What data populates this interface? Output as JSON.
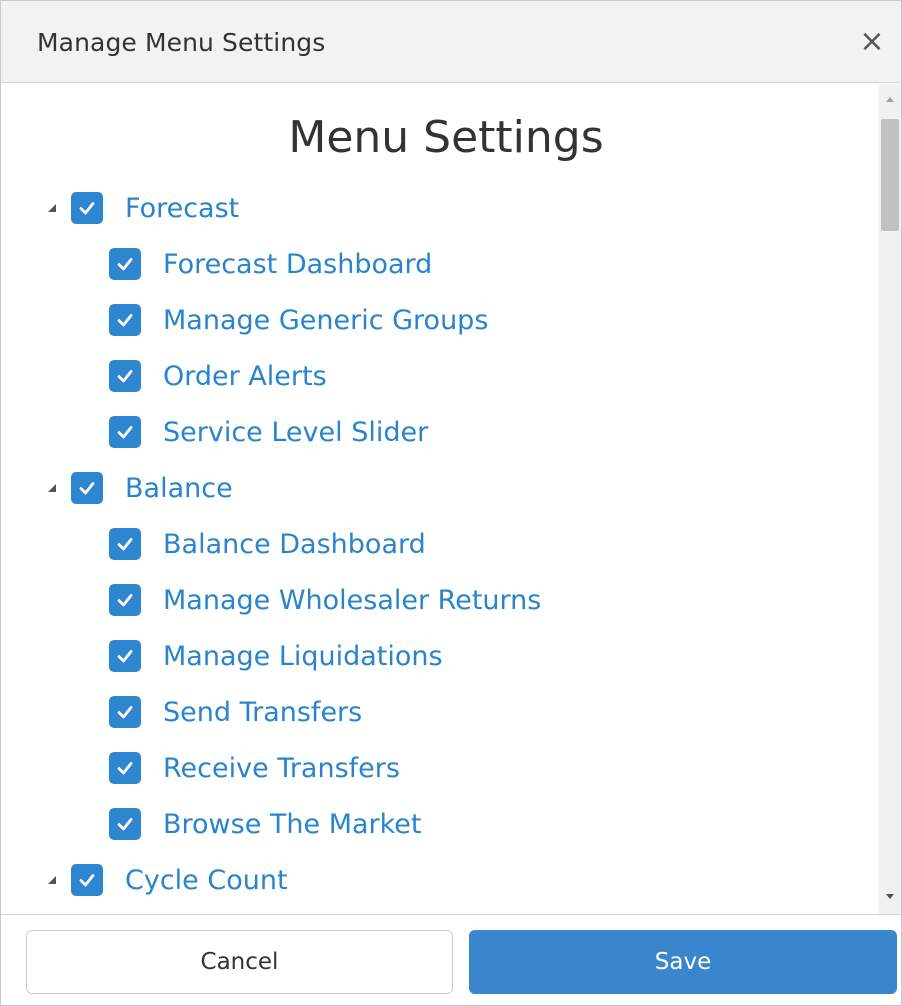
{
  "dialog": {
    "title": "Manage Menu Settings",
    "close_glyph": "×"
  },
  "content": {
    "heading": "Menu Settings",
    "groups": [
      {
        "label": "Forecast",
        "checked": true,
        "expanded": true,
        "items": [
          {
            "label": "Forecast Dashboard",
            "checked": true
          },
          {
            "label": "Manage Generic Groups",
            "checked": true
          },
          {
            "label": "Order Alerts",
            "checked": true
          },
          {
            "label": "Service Level Slider",
            "checked": true
          }
        ]
      },
      {
        "label": "Balance",
        "checked": true,
        "expanded": true,
        "items": [
          {
            "label": "Balance Dashboard",
            "checked": true
          },
          {
            "label": "Manage Wholesaler Returns",
            "checked": true
          },
          {
            "label": "Manage Liquidations",
            "checked": true
          },
          {
            "label": "Send Transfers",
            "checked": true
          },
          {
            "label": "Receive Transfers",
            "checked": true
          },
          {
            "label": "Browse The Market",
            "checked": true
          }
        ]
      },
      {
        "label": "Cycle Count",
        "checked": true,
        "expanded": true,
        "items": []
      }
    ]
  },
  "footer": {
    "cancel_label": "Cancel",
    "save_label": "Save"
  },
  "colors": {
    "accent": "#2e86d1",
    "link_text": "#2a84cc",
    "save_button": "#3a86cc"
  },
  "icons": {
    "expand": "triangle-down-icon",
    "check": "checkmark-icon",
    "close": "close-icon"
  }
}
